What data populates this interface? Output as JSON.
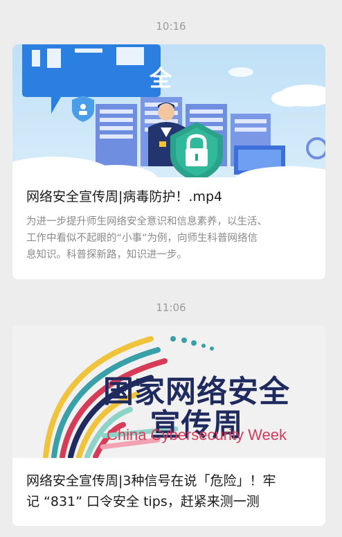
{
  "messages": [
    {
      "time": "10:16",
      "cover_text": "全",
      "title": "网络安全宣传周|病毒防护！.mp4",
      "desc_lines": [
        "为进一步提升师生网络安全意识和信息素养，以生活、",
        "工作中看似不起眼的“小事”为例，向师生科普网络信",
        "息知识。科普探新路，知识进一步。"
      ],
      "colors": {
        "banner": "#2b7fe0",
        "shield": "#2aa38a",
        "sky": "#bfe0f6"
      }
    },
    {
      "time": "11:06",
      "cover_title_line1": "国家网络安全",
      "cover_title_line2": "宣传周",
      "cover_subtitle": "China Cybersecurity Week",
      "title_lines": [
        "网络安全宣传周|3种信号在说「危险」！牢",
        "记 “831” 口令安全 tips，赶紧来测一测"
      ],
      "colors": {
        "title": "#1f2a5e",
        "subtitle": "#d63c57"
      }
    }
  ]
}
